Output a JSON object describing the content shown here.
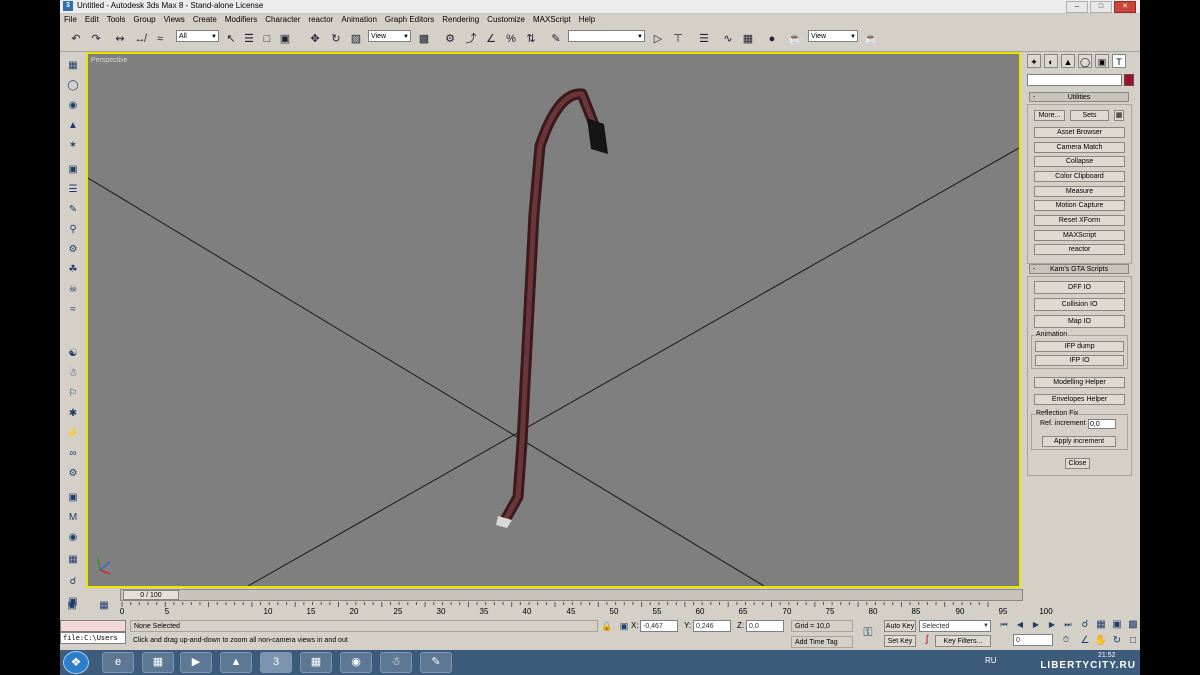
{
  "window": {
    "title": "Untitled - Autodesk 3ds Max 8 - Stand-alone License",
    "app_icon": "3ds-max-icon",
    "buttons": [
      "minimize",
      "maximize",
      "close"
    ]
  },
  "menu": [
    "File",
    "Edit",
    "Tools",
    "Group",
    "Views",
    "Create",
    "Modifiers",
    "Character",
    "reactor",
    "Animation",
    "Graph Editors",
    "Rendering",
    "Customize",
    "MAXScript",
    "Help"
  ],
  "toolbar": {
    "selection_filter": "All",
    "ref_coord_system": "View",
    "named_selection": "",
    "render_type": "View"
  },
  "viewport": {
    "label": "Perspective",
    "border_color": "#f0e200",
    "background": "#7f7f7f",
    "object": "crowbar"
  },
  "command_panel": {
    "name_value": "",
    "object_color": "#a0102a",
    "utilities": {
      "title": "Utilities",
      "more_label": "More...",
      "sets_label": "Sets",
      "buttons": [
        "Asset Browser",
        "Camera Match",
        "Collapse",
        "Color Clipboard",
        "Measure",
        "Motion Capture",
        "Reset XForm",
        "MAXScript",
        "reactor"
      ]
    },
    "kams": {
      "title": "Kam's GTA Scripts",
      "buttons": [
        "DFF IO",
        "Collision IO",
        "Map IO"
      ],
      "animation_title": "Animation",
      "animation_buttons": [
        "IFP dump",
        "IFP IO"
      ],
      "helpers": [
        "Modelling Helper",
        "Envelopes Helper"
      ],
      "reflection_title": "Reflection Fix",
      "ref_increment_label": "Ref. increment",
      "ref_increment_value": "0,0",
      "apply_label": "Apply increment",
      "close_label": "Close"
    }
  },
  "timeline": {
    "frame_display": "0 / 100",
    "ticks": [
      "0",
      "5",
      "10",
      "15",
      "20",
      "25",
      "30",
      "35",
      "40",
      "45",
      "50",
      "55",
      "60",
      "65",
      "70",
      "75",
      "80",
      "85",
      "90",
      "95",
      "100"
    ]
  },
  "status": {
    "maxscript_listener": "file:C:\\Users",
    "selection": "None Selected",
    "prompt": "Click and drag up-and-down to zoom all non-camera views in and out",
    "x_label": "X:",
    "x_value": "-0,467",
    "y_label": "Y:",
    "y_value": "0,246",
    "z_label": "Z:",
    "z_value": "0,0",
    "grid": "Grid = 10,0",
    "add_time_tag": "Add Time Tag",
    "auto_key": "Auto Key",
    "set_key": "Set Key",
    "key_mode_selected": "Selected",
    "key_filters": "Key Filters...",
    "current_frame": "0"
  },
  "taskbar": {
    "language": "RU",
    "clock": "21:52",
    "watermark": "LIBERTYCITY.RU"
  }
}
